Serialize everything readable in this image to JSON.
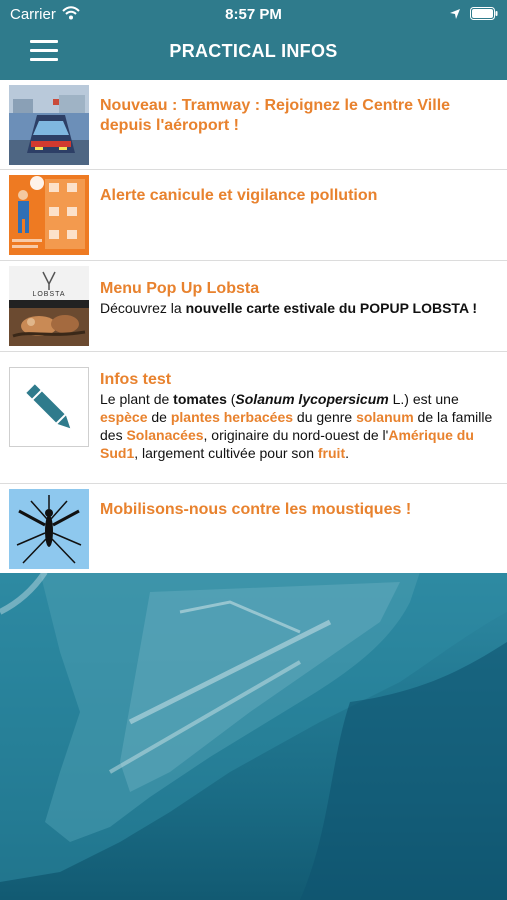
{
  "status_bar": {
    "carrier": "Carrier",
    "time": "8:57 PM"
  },
  "header": {
    "title": "PRACTICAL INFOS",
    "menu_icon": "hamburger-menu-icon"
  },
  "colors": {
    "header_bg": "#2f7b8c",
    "accent": "#e8822e"
  },
  "items": [
    {
      "title": "Nouveau : Tramway : Rejoignez le Centre Ville depuis l'aéroport !",
      "thumbnail": "tramway-photo"
    },
    {
      "title": "Alerte canicule et vigilance pollution",
      "thumbnail": "heatwave-poster"
    },
    {
      "title": "Menu Pop Up Lobsta",
      "desc_p1": "Découvrez la ",
      "desc_b1": "nouvelle carte estivale du POPUP LOBSTA !",
      "thumbnail": "lobsta-photo",
      "thumb_text": "LOBSTA"
    },
    {
      "title": "Infos test",
      "desc": {
        "t1": "Le plant de ",
        "b1": "tomates",
        "t2": " (",
        "i1": "Solanum lycopersicum",
        "t3": " L.) est une ",
        "o1": "espèce",
        "t4": " de ",
        "o2": "plantes herbacées",
        "t5": " du genre ",
        "o3": "solanum",
        "t6": " de la famille des ",
        "o4": "Solanacées",
        "t7": ", originaire du nord-ouest de l'",
        "o5": "Amérique du Sud1",
        "t8": ", largement cultivée pour son ",
        "o6": "fruit",
        "t9": "."
      },
      "thumbnail": "pencil-icon"
    },
    {
      "title": "Mobilisons-nous contre les moustiques !",
      "thumbnail": "mosquito-icon"
    }
  ]
}
